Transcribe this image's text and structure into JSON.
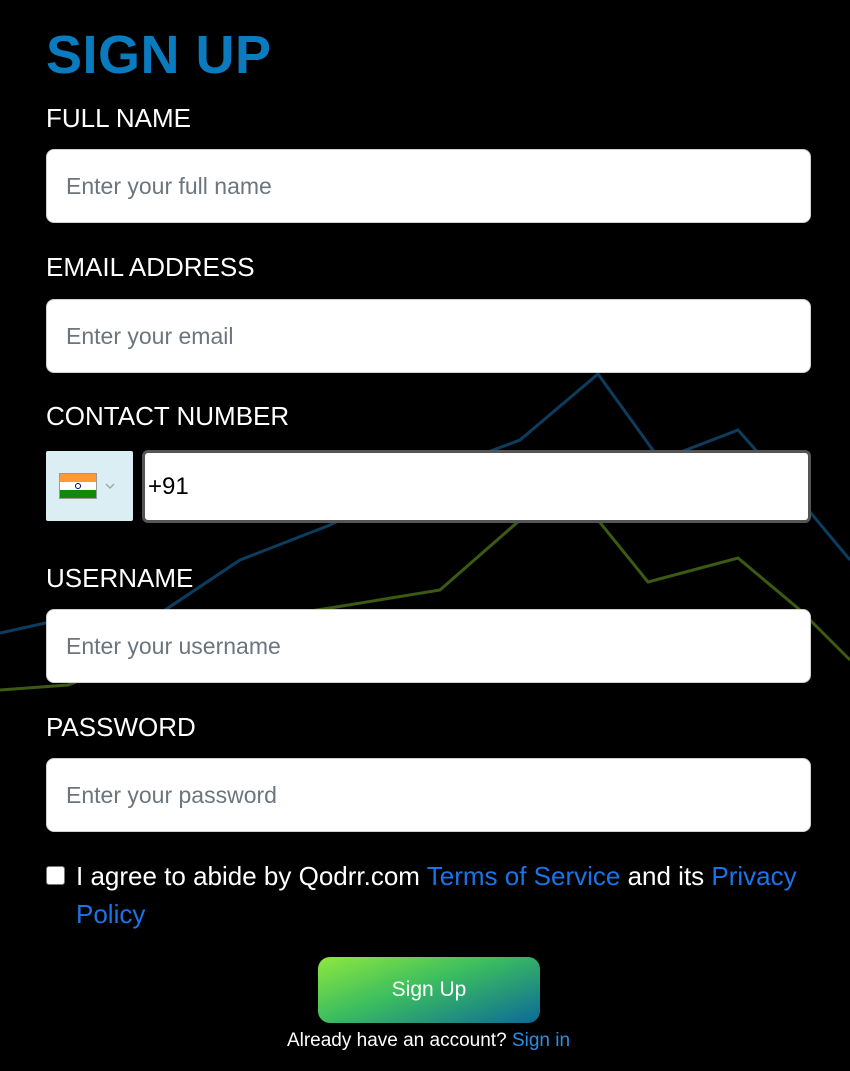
{
  "form": {
    "title": "SIGN UP",
    "full_name": {
      "label": "FULL NAME",
      "placeholder": "Enter your full name",
      "value": ""
    },
    "email": {
      "label": "EMAIL ADDRESS",
      "placeholder": "Enter your email",
      "value": ""
    },
    "contact": {
      "label": "CONTACT NUMBER",
      "country_flag": "india-flag-icon",
      "value": "+91"
    },
    "username": {
      "label": "USERNAME",
      "placeholder": "Enter your username",
      "value": ""
    },
    "password": {
      "label": "PASSWORD",
      "placeholder": "Enter your password",
      "value": ""
    },
    "agree": {
      "text_before": "I agree to abide by Qodrr.com ",
      "terms_link": "Terms of Service",
      "text_middle": " and its ",
      "privacy_link": "Privacy Policy",
      "checked": false
    },
    "submit_label": "Sign Up",
    "signin_prompt": "Already have an account? ",
    "signin_link": "Sign in"
  },
  "colors": {
    "background": "#000000",
    "title": "#0a7bbf",
    "link": "#1a73e8",
    "button_gradient_start": "#8ee83e",
    "button_gradient_end": "#0b6a98"
  }
}
